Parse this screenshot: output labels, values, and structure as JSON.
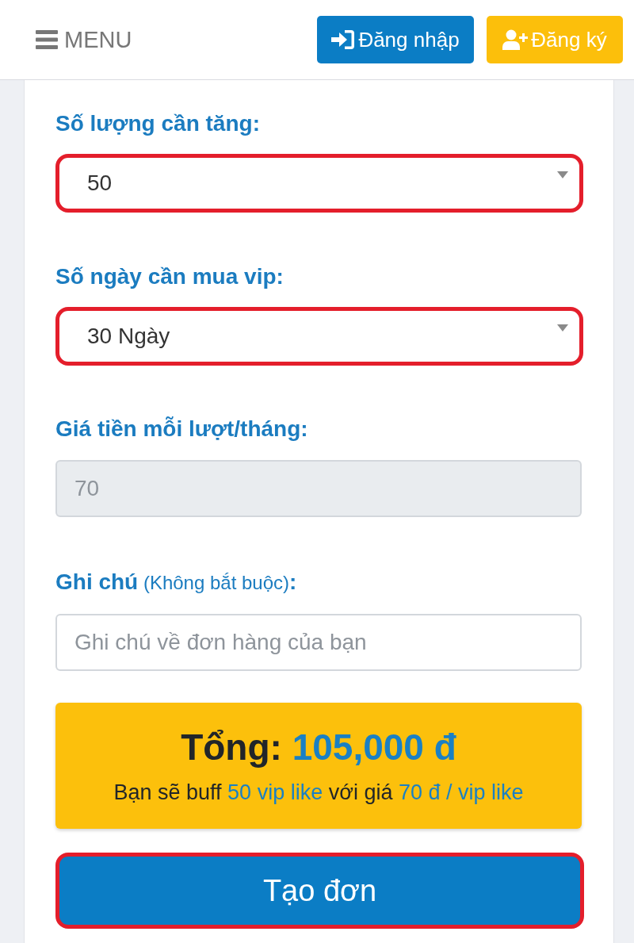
{
  "header": {
    "menu": {
      "label": "MENU"
    },
    "buttons": [
      {
        "kind": "login",
        "label": "Đăng nhập"
      },
      {
        "kind": "register",
        "label": "Đăng ký"
      }
    ]
  },
  "form": {
    "fields": [
      {
        "kind": "select",
        "label": [
          {
            "kind": "bold",
            "text": "Số lượng cần tăng:"
          }
        ],
        "value": "50",
        "disabled": false,
        "highlighted": true
      },
      {
        "kind": "select",
        "label": [
          {
            "kind": "bold",
            "text": "Số ngày cần mua vip:"
          }
        ],
        "value": "30 Ngày",
        "disabled": false,
        "highlighted": true
      },
      {
        "kind": "input",
        "label": [
          {
            "kind": "bold",
            "text": "Giá tiền mỗi lượt/tháng:"
          }
        ],
        "value": "70",
        "disabled": true,
        "highlighted": false
      },
      {
        "kind": "input",
        "label": [
          {
            "kind": "bold",
            "text": "Ghi chú"
          },
          {
            "kind": "note",
            "text": " (Không bắt buộc)"
          },
          {
            "kind": "bold",
            "text": ":"
          }
        ],
        "placeholder": "Ghi chú về đơn hàng của bạn",
        "disabled": false,
        "highlighted": false
      }
    ],
    "total": {
      "label": "Tổng:",
      "amount": "105,000 đ",
      "description": [
        {
          "kind": "plain",
          "text": "Bạn sẽ buff "
        },
        {
          "kind": "value",
          "text": "50 vip like"
        },
        {
          "kind": "plain",
          "text": " với giá "
        },
        {
          "kind": "value",
          "text": "70 đ / vip like"
        }
      ]
    },
    "submit": {
      "label": "Tạo đơn",
      "highlighted": true
    }
  }
}
